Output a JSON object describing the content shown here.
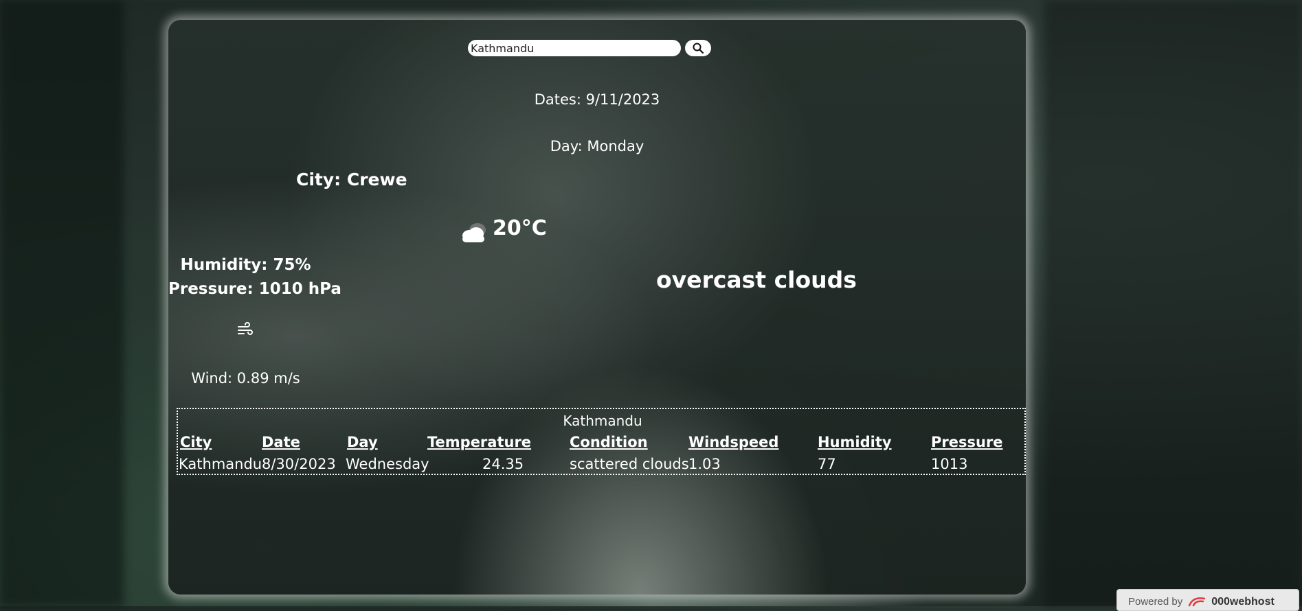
{
  "search": {
    "value": "Kathmandu"
  },
  "current": {
    "dates_text": "Dates: 9/11/2023",
    "day_text": "Day: Monday",
    "city_text": "City: Crewe",
    "temperature_text": "20°C",
    "condition": "overcast clouds",
    "humidity_text": "Humidity: 75%",
    "pressure_text": "Pressure: 1010 hPa",
    "wind_text": "Wind: 0.89 m/s"
  },
  "history": {
    "city_heading": "Kathmandu",
    "headers": [
      "City",
      "Date",
      "Day",
      "Temperature",
      "Condition",
      "Windspeed",
      "Humidity",
      "Pressure"
    ],
    "rows": [
      [
        "Kathmandu",
        "8/30/2023",
        "Wednesday",
        "24.35",
        "scattered clouds",
        "1.03",
        "77",
        "1013"
      ]
    ]
  },
  "footer": {
    "powered_label": "Powered by",
    "brand": "000webhost"
  },
  "icons": {
    "search": "search-icon",
    "weather": "cloud-icon",
    "wind": "wind-icon",
    "brand": "webhost-logo-icon"
  },
  "colors": {
    "text": "#ffffff",
    "input_bg": "#ffffff",
    "badge_bg": "#e9e9e9",
    "brand_red": "#e03a3e"
  }
}
